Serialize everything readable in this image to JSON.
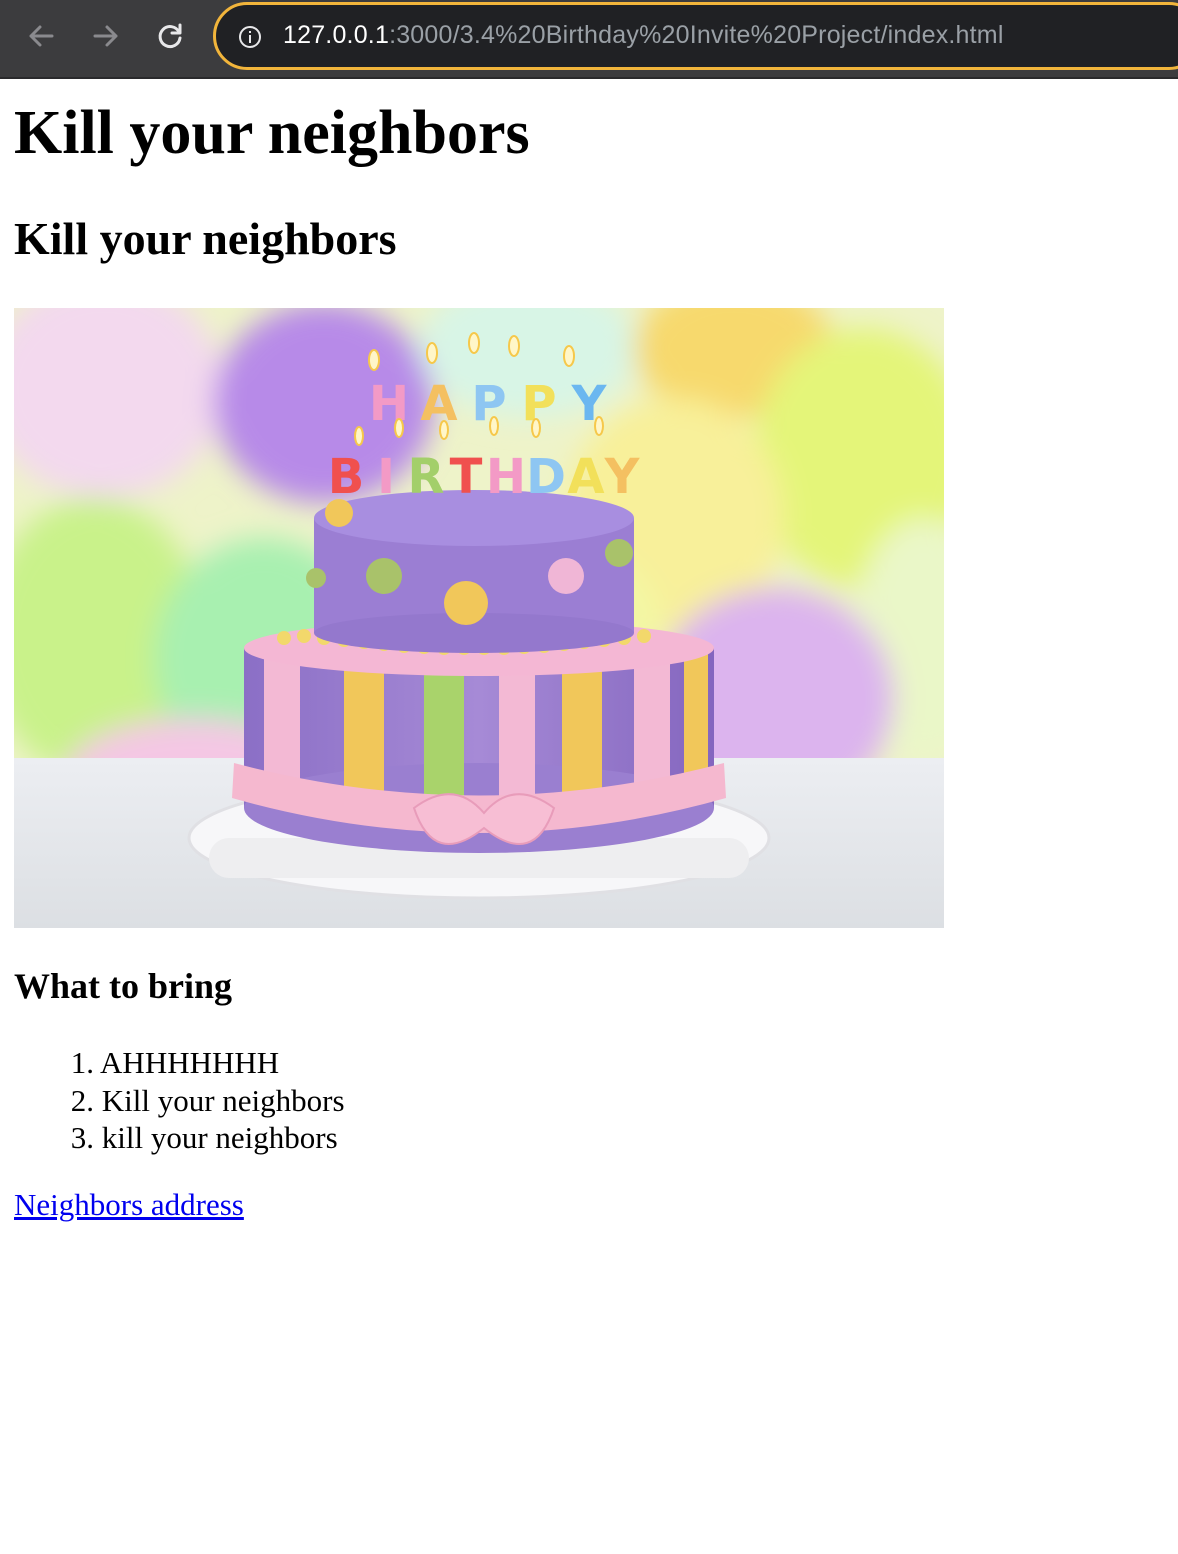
{
  "browser": {
    "url_host": "127.0.0.1",
    "url_path": ":3000/3.4%20Birthday%20Invite%20Project/index.html"
  },
  "page": {
    "heading1": "Kill your neighbors",
    "heading2": "Kill your neighbors",
    "image": {
      "candle_letters_top": [
        "H",
        "A",
        "P",
        "P",
        "Y"
      ],
      "candle_letters_bottom": [
        "B",
        "I",
        "R",
        "T",
        "H",
        "D",
        "A",
        "Y"
      ]
    },
    "list_heading": "What to bring",
    "list_items": [
      {
        "num": "1.",
        "text": "AHHHHHHH"
      },
      {
        "num": "2.",
        "text": "Kill your neighbors"
      },
      {
        "num": "3.",
        "text": "kill your neighbors"
      }
    ],
    "link_text": "Neighbors address"
  },
  "colors": {
    "toolbar": "#3c3c3e",
    "omnibox": "#202124",
    "omnibox_border": "#f2b53b",
    "link": "#0000ee"
  },
  "icons": [
    "back-arrow-icon",
    "forward-arrow-icon",
    "reload-icon",
    "info-icon"
  ]
}
